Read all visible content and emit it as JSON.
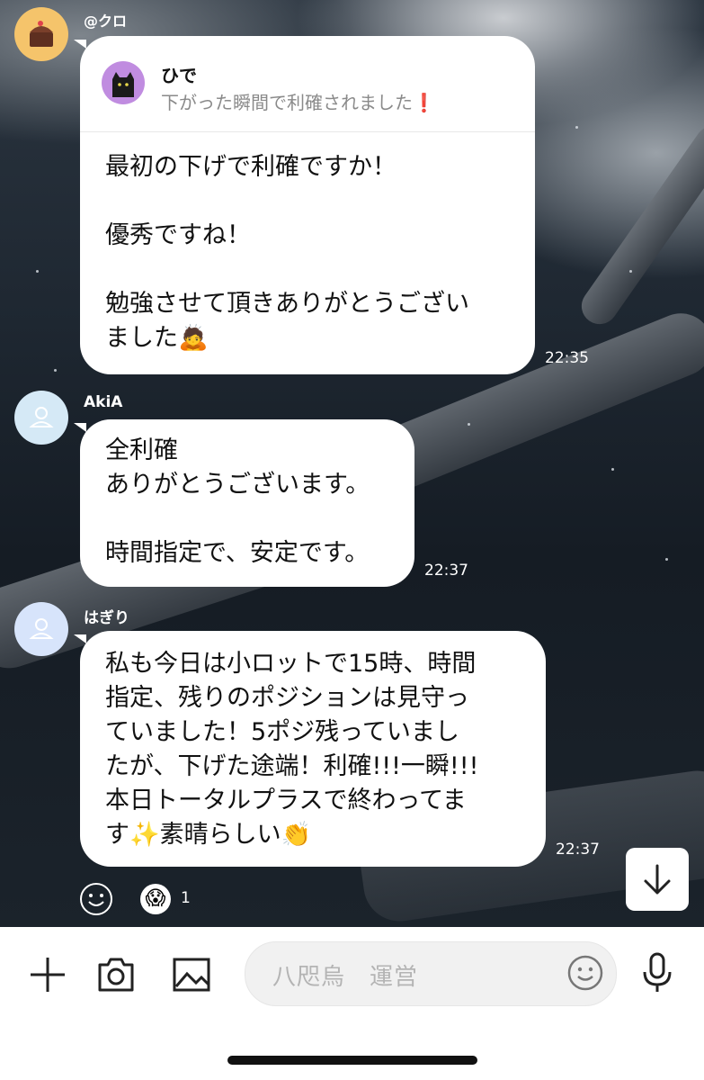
{
  "messages": [
    {
      "sender": "@クロ",
      "quote": {
        "name": "ひで",
        "text": "下がった瞬間で利確されました",
        "emoji": "❗"
      },
      "text": "最初の下げで利確ですか！\n\n優秀ですね！\n\n勉強させて頂きありがとうござい\nました🙇",
      "time": "22:35"
    },
    {
      "sender": "AkiA",
      "text": "全利確\nありがとうございます。\n\n時間指定で、安定です。",
      "time": "22:37"
    },
    {
      "sender": "はぎり",
      "text": "私も今日は小ロットで15時、時間\n指定、残りのポジションは見守っ\nていました！5ポジ残っていまし\nたが、下げた途端！利確!!!一瞬!!!\n本日トータルプラスで終わってま\nす✨素晴らしい👏",
      "time": "22:37"
    }
  ],
  "reactions": {
    "emoji_face": "😱",
    "count": "1"
  },
  "composer": {
    "placeholder": "八咫烏　運営"
  },
  "icons": [
    "plus-icon",
    "camera-icon",
    "image-icon",
    "emoji-icon",
    "microphone-icon",
    "arrow-down-icon",
    "smiley-reaction-icon"
  ]
}
